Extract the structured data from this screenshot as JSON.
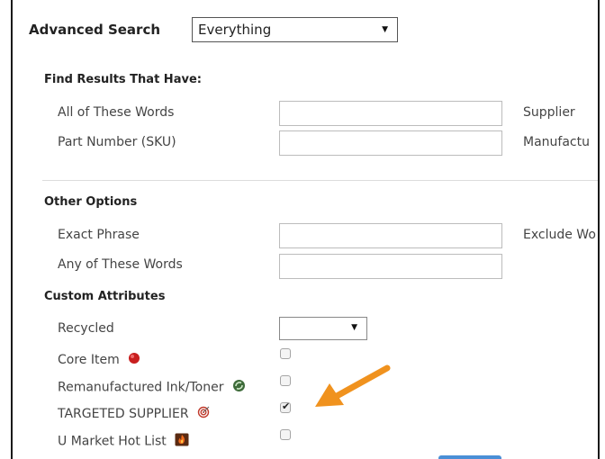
{
  "header": {
    "title": "Advanced Search",
    "scope_value": "Everything"
  },
  "find_results": {
    "title": "Find Results That Have:",
    "rows": [
      {
        "label": "All of These Words",
        "side_label": "Supplier"
      },
      {
        "label": "Part Number (SKU)",
        "side_label": "Manufactu"
      }
    ]
  },
  "other_options": {
    "title": "Other Options",
    "rows": [
      {
        "label": "Exact Phrase",
        "side_label": "Exclude Wo"
      },
      {
        "label": "Any of These Words"
      }
    ]
  },
  "custom_attributes": {
    "title": "Custom Attributes",
    "recycled_label": "Recycled",
    "recycled_value": "",
    "items": [
      {
        "label": "Core Item",
        "icon": "red-ball-icon",
        "checked": false
      },
      {
        "label": "Remanufactured Ink/Toner",
        "icon": "recycle-icon",
        "checked": false
      },
      {
        "label": "TARGETED SUPPLIER",
        "icon": "target-icon",
        "checked": true
      },
      {
        "label": "U Market Hot List",
        "icon": "hot-list-icon",
        "checked": false
      }
    ]
  },
  "colors": {
    "annotation_arrow": "#f0921e",
    "button": "#4a8fd6"
  }
}
